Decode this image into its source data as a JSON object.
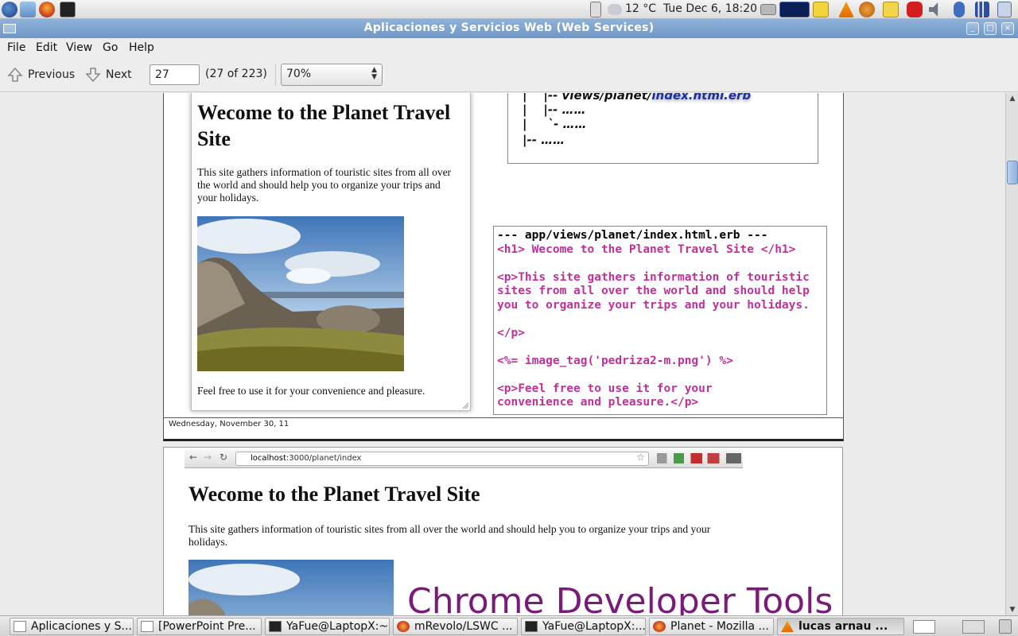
{
  "top_panel": {
    "temperature": "12 °C",
    "datetime": "Tue Dec  6, 18:20"
  },
  "window": {
    "title": "Aplicaciones y Servicios Web (Web Services)"
  },
  "menu": {
    "file": "File",
    "edit": "Edit",
    "view": "View",
    "go": "Go",
    "help": "Help"
  },
  "toolbar": {
    "previous_label": "Previous",
    "next_label": "Next",
    "page_value": "27",
    "page_count": "(27 of 223)",
    "zoom_value": "70%"
  },
  "slide1": {
    "browser": {
      "heading": "Wecome to the Planet Travel Site",
      "paragraph": "This site gathers information of touristic sites from all over the world and should help you to organize your trips and your holidays.",
      "footer_text": "Feel free to use it for your convenience and pleasure."
    },
    "tree": {
      "line1_prefix": "|    |-- views/planet/",
      "line1_highlight": "index.html.erb",
      "line2": "|    |-- ……",
      "line3": "|     `- ……",
      "line4": "|-- ……"
    },
    "code": {
      "header": "--- app/views/planet/index.html.erb ---",
      "lines": [
        "<h1> Wecome to the Planet Travel Site </h1>",
        "",
        "<p>This site gathers information of touristic",
        "sites from all over the world and should help",
        "you to organize your trips and your holidays.",
        "",
        "</p>",
        "",
        "<%= image_tag('pedriza2-m.png') %>",
        "",
        "<p>Feel free to use it for your",
        "convenience and pleasure.</p>"
      ]
    },
    "date_footer": "Wednesday, November 30, 11"
  },
  "slide2": {
    "url_host": "localhost",
    "url_path": ":3000/planet/index",
    "heading": "Wecome to the Planet Travel Site",
    "paragraph": "This site gathers information of touristic sites from all over the world and should help you to organize your trips and your holidays.",
    "overlay_title": "Chrome Developer Tools"
  },
  "taskbar": {
    "items": [
      "Aplicaciones y S...",
      "[PowerPoint Pre...",
      "YaFue@LaptopX:~",
      "mRevolo/LSWC ...",
      "YaFue@LaptopX:...",
      "Planet - Mozilla ...",
      "lucas arnau    ..."
    ]
  },
  "colors": {
    "code_magenta": "#c0309c",
    "titlebar_blue": "#7aa0cd",
    "chrome_dev_purple": "#7a1b7a"
  }
}
